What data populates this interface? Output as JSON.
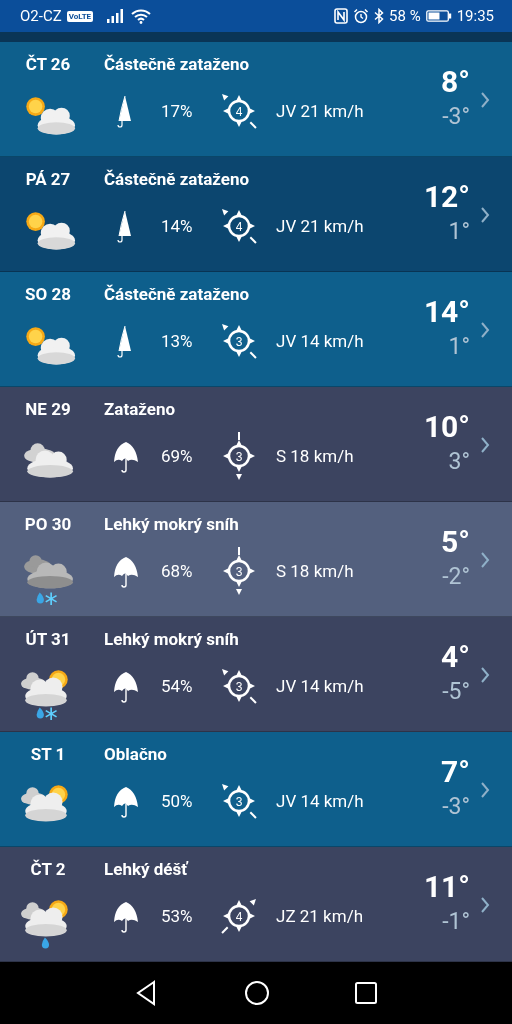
{
  "status_bar": {
    "carrier": "O2-CZ",
    "volte": "VoLTE",
    "battery_percent": "58 %",
    "time": "19:35"
  },
  "days": [
    {
      "day": "ČT 26",
      "condition": "Částečně zataženo",
      "weather_icon": {
        "kind": "suncloud"
      },
      "umbrella_icon": {
        "kind": "closed"
      },
      "precip": "17%",
      "wind_arrow": {
        "kind": "nw"
      },
      "wind_force": "4",
      "wind": "JV 21 km/h",
      "high": "8°",
      "low": "-3°",
      "color": "#0e5f8c"
    },
    {
      "day": "PÁ 27",
      "condition": "Částečně zataženo",
      "weather_icon": {
        "kind": "suncloud"
      },
      "umbrella_icon": {
        "kind": "closed"
      },
      "precip": "14%",
      "wind_arrow": {
        "kind": "nw"
      },
      "wind_force": "4",
      "wind": "JV 21 km/h",
      "high": "12°",
      "low": "1°",
      "color": "#0c466f"
    },
    {
      "day": "SO 28",
      "condition": "Částečně zataženo",
      "weather_icon": {
        "kind": "suncloud"
      },
      "umbrella_icon": {
        "kind": "closed"
      },
      "precip": "13%",
      "wind_arrow": {
        "kind": "nw"
      },
      "wind_force": "3",
      "wind": "JV 14 km/h",
      "high": "14°",
      "low": "1°",
      "color": "#0e5f8c"
    },
    {
      "day": "NE 29",
      "condition": "Zataženo",
      "weather_icon": {
        "kind": "cloud"
      },
      "umbrella_icon": {
        "kind": "open"
      },
      "precip": "69%",
      "wind_arrow": {
        "kind": "s"
      },
      "wind_force": "3",
      "wind": "S 18 km/h",
      "high": "10°",
      "low": "3°",
      "color": "#3c4460"
    },
    {
      "day": "PO 30",
      "condition": "Lehký mokrý sníh",
      "weather_icon": {
        "kind": "cloudsleet"
      },
      "umbrella_icon": {
        "kind": "open"
      },
      "precip": "68%",
      "wind_arrow": {
        "kind": "s"
      },
      "wind_force": "3",
      "wind": "S 18 km/h",
      "high": "5°",
      "low": "-2°",
      "color": "#53607e"
    },
    {
      "day": "ÚT 31",
      "condition": "Lehký mokrý sníh",
      "weather_icon": {
        "kind": "sunsleet"
      },
      "umbrella_icon": {
        "kind": "open"
      },
      "precip": "54%",
      "wind_arrow": {
        "kind": "nw"
      },
      "wind_force": "3",
      "wind": "JV 14 km/h",
      "high": "4°",
      "low": "-5°",
      "color": "#3c4460"
    },
    {
      "day": "ST 1",
      "condition": "Oblačno",
      "weather_icon": {
        "kind": "sunbehind"
      },
      "umbrella_icon": {
        "kind": "open"
      },
      "precip": "50%",
      "wind_arrow": {
        "kind": "nw"
      },
      "wind_force": "3",
      "wind": "JV 14 km/h",
      "high": "7°",
      "low": "-3°",
      "color": "#0e5f8c"
    },
    {
      "day": "ČT 2",
      "condition": "Lehký déšť",
      "weather_icon": {
        "kind": "sunrain"
      },
      "umbrella_icon": {
        "kind": "open"
      },
      "precip": "53%",
      "wind_arrow": {
        "kind": "ne"
      },
      "wind_force": "4",
      "wind": "JZ 21 km/h",
      "high": "11°",
      "low": "-1°",
      "color": "#3c4460"
    }
  ]
}
